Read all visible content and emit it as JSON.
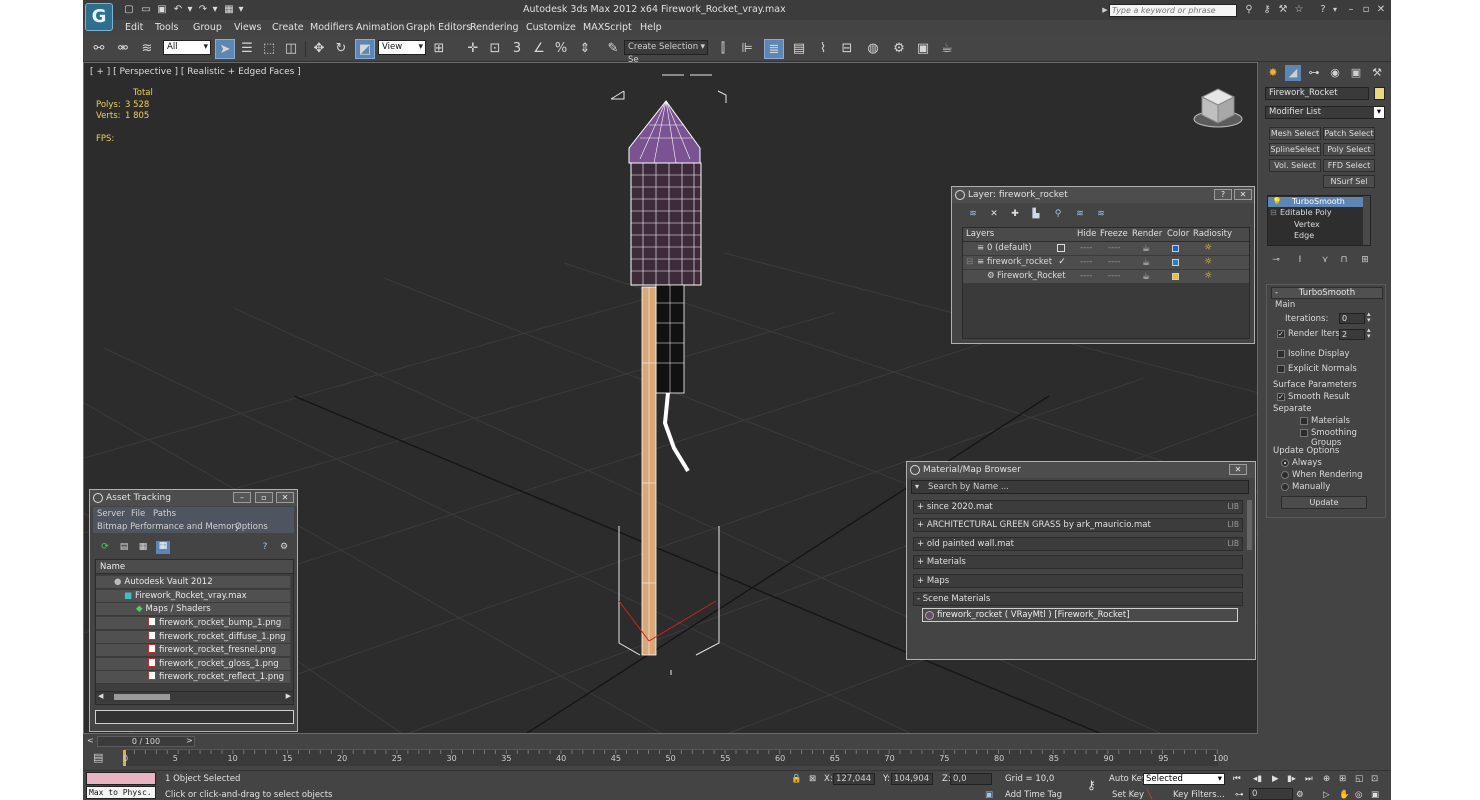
{
  "titlebar": {
    "app_logo": "G",
    "title": "Autodesk 3ds Max  2012 x64      Firework_Rocket_vray.max",
    "search_placeholder": "Type a keyword or phrase"
  },
  "menu": {
    "items": [
      "Edit",
      "Tools",
      "Group",
      "Views",
      "Create",
      "Modifiers",
      "Animation",
      "Graph Editors",
      "Rendering",
      "Customize",
      "MAXScript",
      "Help"
    ]
  },
  "toolbar": {
    "selection_filter": "All",
    "ref_coord": "View",
    "named_selection": "Create Selection Se",
    "snap_label": "3",
    "percent_label": "%"
  },
  "viewport": {
    "label": "[ + ] [ Perspective ] [ Realistic + Edged Faces ]",
    "stats": {
      "total_label": "Total",
      "polys_label": "Polys:",
      "polys_value": "3 528",
      "verts_label": "Verts:",
      "verts_value": "1 805",
      "fps_label": "FPS:"
    }
  },
  "layer_window": {
    "title": "Layer: firework_rocket",
    "columns": [
      "Layers",
      "Hide",
      "Freeze",
      "Render",
      "Color",
      "Radiosity"
    ],
    "rows": [
      {
        "name": "0 (default)",
        "color": "#1f5fd6"
      },
      {
        "name": "firework_rocket",
        "color": "#1d84c8"
      },
      {
        "name": "Firework_Rocket",
        "color": "#e8c22a"
      }
    ],
    "hide_dash": "----",
    "freeze_dash": "----"
  },
  "material_browser": {
    "title": "Material/Map Browser",
    "search_placeholder": "Search by Name ...",
    "groups": [
      {
        "label": "+ since 2020.mat",
        "tag": "LIB"
      },
      {
        "label": "+ ARCHITECTURAL GREEN GRASS by ark_mauricio.mat",
        "tag": "LIB"
      },
      {
        "label": "+ old painted wall.mat",
        "tag": "LIB"
      },
      {
        "label": "+ Materials",
        "tag": ""
      },
      {
        "label": "+ Maps",
        "tag": ""
      },
      {
        "label": "- Scene Materials",
        "tag": ""
      }
    ],
    "scene_item": "firework_rocket  ( VRayMtl )  [Firework_Rocket]"
  },
  "asset_tracking": {
    "title": "Asset Tracking",
    "menu_row1": [
      "Server",
      "File",
      "Paths"
    ],
    "menu_row2": [
      "Bitmap Performance and Memory",
      "Options"
    ],
    "column_header": "Name",
    "tree": [
      {
        "label": "Autodesk Vault 2012",
        "indent": 1
      },
      {
        "label": "Firework_Rocket_vray.max",
        "indent": 2
      },
      {
        "label": "Maps / Shaders",
        "indent": 3
      },
      {
        "label": "firework_rocket_bump_1.png",
        "indent": 4
      },
      {
        "label": "firework_rocket_diffuse_1.png",
        "indent": 4
      },
      {
        "label": "firework_rocket_fresnel.png",
        "indent": 4
      },
      {
        "label": "firework_rocket_gloss_1.png",
        "indent": 4
      },
      {
        "label": "firework_rocket_reflect_1.png",
        "indent": 4
      }
    ]
  },
  "command_panel": {
    "object_name": "Firework_Rocket",
    "object_color": "#e8d880",
    "modifier_list": "Modifier List",
    "buttons": [
      "Mesh Select",
      "Patch Select",
      "SplineSelect",
      "Poly Select",
      "Vol. Select",
      "FFD Select",
      "NSurf Sel"
    ],
    "stack": [
      "TurboSmooth",
      "Editable Poly",
      "Vertex",
      "Edge"
    ],
    "turbosmooth": {
      "title": "TurboSmooth",
      "main_label": "Main",
      "iterations_label": "Iterations:",
      "iterations_value": "0",
      "render_iters_label": "Render Iters:",
      "render_iters_value": "2",
      "isoline_label": "Isoline Display",
      "explicit_label": "Explicit Normals",
      "surface_label": "Surface Parameters",
      "smooth_result_label": "Smooth Result",
      "separate_label": "Separate",
      "materials_label": "Materials",
      "smoothing_label": "Smoothing Groups",
      "update_options_label": "Update Options",
      "always_label": "Always",
      "when_rendering_label": "When Rendering",
      "manually_label": "Manually",
      "update_button": "Update"
    }
  },
  "timeline": {
    "slider_label": "0 / 100",
    "ticks": [
      "0",
      "5",
      "10",
      "15",
      "20",
      "25",
      "30",
      "35",
      "40",
      "45",
      "50",
      "55",
      "60",
      "65",
      "70",
      "75",
      "80",
      "85",
      "90",
      "95",
      "100"
    ]
  },
  "status": {
    "maxscript_label": "Max to Physc.",
    "selected": "1 Object Selected",
    "prompt": "Click or click-and-drag to select objects",
    "x_label": "X:",
    "x_value": "127,044",
    "y_label": "Y:",
    "y_value": "104,904",
    "z_label": "Z:",
    "z_value": "0,0",
    "grid": "Grid = 10,0",
    "add_time_tag": "Add Time Tag",
    "auto_key": "Auto Key",
    "set_key": "Set Key",
    "selected_dropdown": "Selected",
    "key_filters": "Key Filters...",
    "frame_value": "0"
  }
}
